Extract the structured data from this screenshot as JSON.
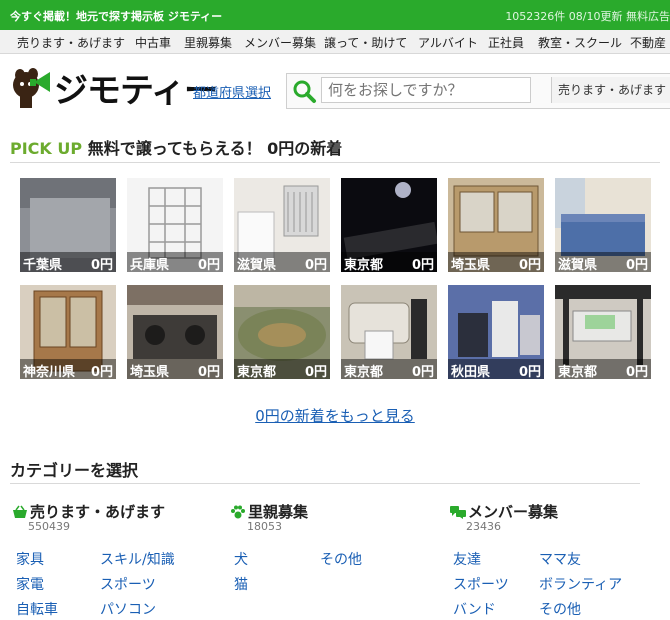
{
  "topbar": {
    "tagline": "今すぐ掲載！地元で探す掲示板 ジモティー",
    "stats": "1052326件 08/10更新 無料広告"
  },
  "nav": [
    "売ります・あげます",
    "中古車",
    "里親募集",
    "メンバー募集",
    "譲って・助けて",
    "アルバイト",
    "正社員",
    "教室・スクール",
    "不動産"
  ],
  "header": {
    "logo_text": "ジモティー",
    "pref_link": "都道府県選択",
    "search_placeholder": "何をお探しですか？",
    "search_category": "売ります・あげます"
  },
  "pickup": {
    "label": "PICK UP",
    "title": "無料で譲ってもらえる！ 0円の新着",
    "items": [
      {
        "pref": "千葉県",
        "price": "0円"
      },
      {
        "pref": "兵庫県",
        "price": "0円"
      },
      {
        "pref": "滋賀県",
        "price": "0円"
      },
      {
        "pref": "東京都",
        "price": "0円"
      },
      {
        "pref": "埼玉県",
        "price": "0円"
      },
      {
        "pref": "滋賀県",
        "price": "0円"
      },
      {
        "pref": "神奈川県",
        "price": "0円"
      },
      {
        "pref": "埼玉県",
        "price": "0円"
      },
      {
        "pref": "東京都",
        "price": "0円"
      },
      {
        "pref": "東京都",
        "price": "0円"
      },
      {
        "pref": "秋田県",
        "price": "0円"
      },
      {
        "pref": "東京都",
        "price": "0円"
      }
    ],
    "more_link": "0円の新着をもっと見る"
  },
  "categories": {
    "title": "カテゴリーを選択",
    "columns": [
      {
        "name": "売ります・あげます",
        "count": "550439",
        "icon": "basket-icon",
        "links": [
          "家具",
          "スキル/知識",
          "家電",
          "スポーツ",
          "自転車",
          "パソコン"
        ]
      },
      {
        "name": "里親募集",
        "count": "18053",
        "icon": "paw-icon",
        "links": [
          "犬",
          "その他",
          "猫"
        ]
      },
      {
        "name": "メンバー募集",
        "count": "23436",
        "icon": "chat-bubbles-icon",
        "links": [
          "友達",
          "ママ友",
          "スポーツ",
          "ボランティア",
          "バンド",
          "その他"
        ]
      }
    ]
  },
  "colors": {
    "brand_green": "#2aaa2c",
    "accent_green": "#6cab2e",
    "link_blue": "#1a5fb4"
  }
}
